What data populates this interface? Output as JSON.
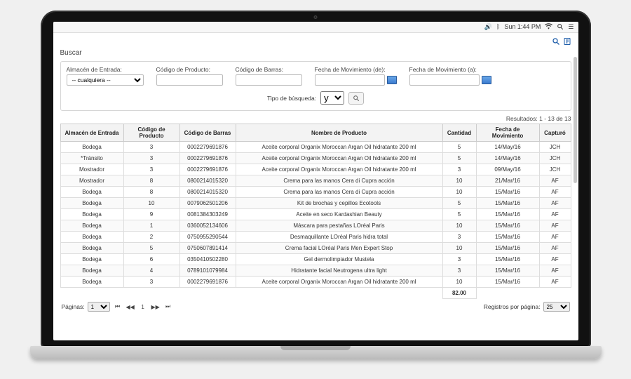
{
  "menubar": {
    "clock": "Sun 1:44 PM"
  },
  "search": {
    "title": "Buscar",
    "labels": {
      "almacen": "Almacén de Entrada:",
      "codigo_producto": "Código de Producto:",
      "codigo_barras": "Código de Barras:",
      "fecha_de": "Fecha de Movimiento (de):",
      "fecha_a": "Fecha de Movimiento (a):",
      "tipo_busqueda": "Tipo de búsqueda:"
    },
    "almacen_value": "-- cualquiera --",
    "tipo_value": "y"
  },
  "results": {
    "count_label": "Resultados: 1 - 13 de 13",
    "headers": {
      "almacen": "Almacén de Entrada",
      "codigo_producto": "Código de Producto",
      "codigo_barras": "Código de Barras",
      "nombre": "Nombre de Producto",
      "cantidad": "Cantidad",
      "fecha": "Fecha de Movimiento",
      "capturo": "Capturó"
    },
    "rows": [
      {
        "almacen": "Bodega",
        "codigo": "3",
        "barras": "0002279691876",
        "nombre": "Aceite corporal Organix Moroccan Argan Oil hidratante 200 ml",
        "cantidad": "5",
        "fecha": "14/May/16",
        "capturo": "JCH"
      },
      {
        "almacen": "*Tránsito",
        "codigo": "3",
        "barras": "0002279691876",
        "nombre": "Aceite corporal Organix Moroccan Argan Oil hidratante 200 ml",
        "cantidad": "5",
        "fecha": "14/May/16",
        "capturo": "JCH"
      },
      {
        "almacen": "Mostrador",
        "codigo": "3",
        "barras": "0002279691876",
        "nombre": "Aceite corporal Organix Moroccan Argan Oil hidratante 200 ml",
        "cantidad": "3",
        "fecha": "09/May/16",
        "capturo": "JCH"
      },
      {
        "almacen": "Mostrador",
        "codigo": "8",
        "barras": "0800214015320",
        "nombre": "Crema para las manos Cera di Cupra acción",
        "cantidad": "10",
        "fecha": "21/Mar/16",
        "capturo": "AF"
      },
      {
        "almacen": "Bodega",
        "codigo": "8",
        "barras": "0800214015320",
        "nombre": "Crema para las manos Cera di Cupra acción",
        "cantidad": "10",
        "fecha": "15/Mar/16",
        "capturo": "AF"
      },
      {
        "almacen": "Bodega",
        "codigo": "10",
        "barras": "0079062501206",
        "nombre": "Kit de brochas y cepillos Ecotools",
        "cantidad": "5",
        "fecha": "15/Mar/16",
        "capturo": "AF"
      },
      {
        "almacen": "Bodega",
        "codigo": "9",
        "barras": "0081384303249",
        "nombre": "Aceite en seco Kardashian Beauty",
        "cantidad": "5",
        "fecha": "15/Mar/16",
        "capturo": "AF"
      },
      {
        "almacen": "Bodega",
        "codigo": "1",
        "barras": "0360052134606",
        "nombre": "Máscara para pestañas LOréal Paris",
        "cantidad": "10",
        "fecha": "15/Mar/16",
        "capturo": "AF"
      },
      {
        "almacen": "Bodega",
        "codigo": "2",
        "barras": "0750955290544",
        "nombre": "Desmaquillante LOréal Paris hidra total",
        "cantidad": "3",
        "fecha": "15/Mar/16",
        "capturo": "AF"
      },
      {
        "almacen": "Bodega",
        "codigo": "5",
        "barras": "0750607891414",
        "nombre": "Crema facial LOréal Paris Men Expert Stop",
        "cantidad": "10",
        "fecha": "15/Mar/16",
        "capturo": "AF"
      },
      {
        "almacen": "Bodega",
        "codigo": "6",
        "barras": "0350410502280",
        "nombre": "Gel dermolimpiador Mustela",
        "cantidad": "3",
        "fecha": "15/Mar/16",
        "capturo": "AF"
      },
      {
        "almacen": "Bodega",
        "codigo": "4",
        "barras": "0789101079984",
        "nombre": "Hidratante facial Neutrogena ultra light",
        "cantidad": "3",
        "fecha": "15/Mar/16",
        "capturo": "AF"
      },
      {
        "almacen": "Bodega",
        "codigo": "3",
        "barras": "0002279691876",
        "nombre": "Aceite corporal Organix Moroccan Argan Oil hidratante 200 ml",
        "cantidad": "10",
        "fecha": "15/Mar/16",
        "capturo": "AF"
      }
    ],
    "total": "82.00"
  },
  "pager": {
    "label": "Páginas:",
    "page": "1",
    "per_page_label": "Registros por página:",
    "per_page": "25"
  }
}
